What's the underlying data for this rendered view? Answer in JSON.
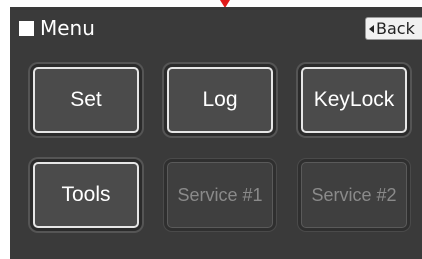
{
  "header": {
    "title": "Menu",
    "back_label": "Back"
  },
  "buttons": {
    "set": "Set",
    "log": "Log",
    "keylock": "KeyLock",
    "tools": "Tools",
    "service1": "Service #1",
    "service2": "Service #2"
  },
  "colors": {
    "screen_bg": "#3a3a3a",
    "indicator": "#e01a1a",
    "disabled_text": "#8a8a8a"
  },
  "icons": {
    "menu": "square-icon",
    "back": "left-triangle-icon",
    "indicator": "down-triangle-icon"
  }
}
